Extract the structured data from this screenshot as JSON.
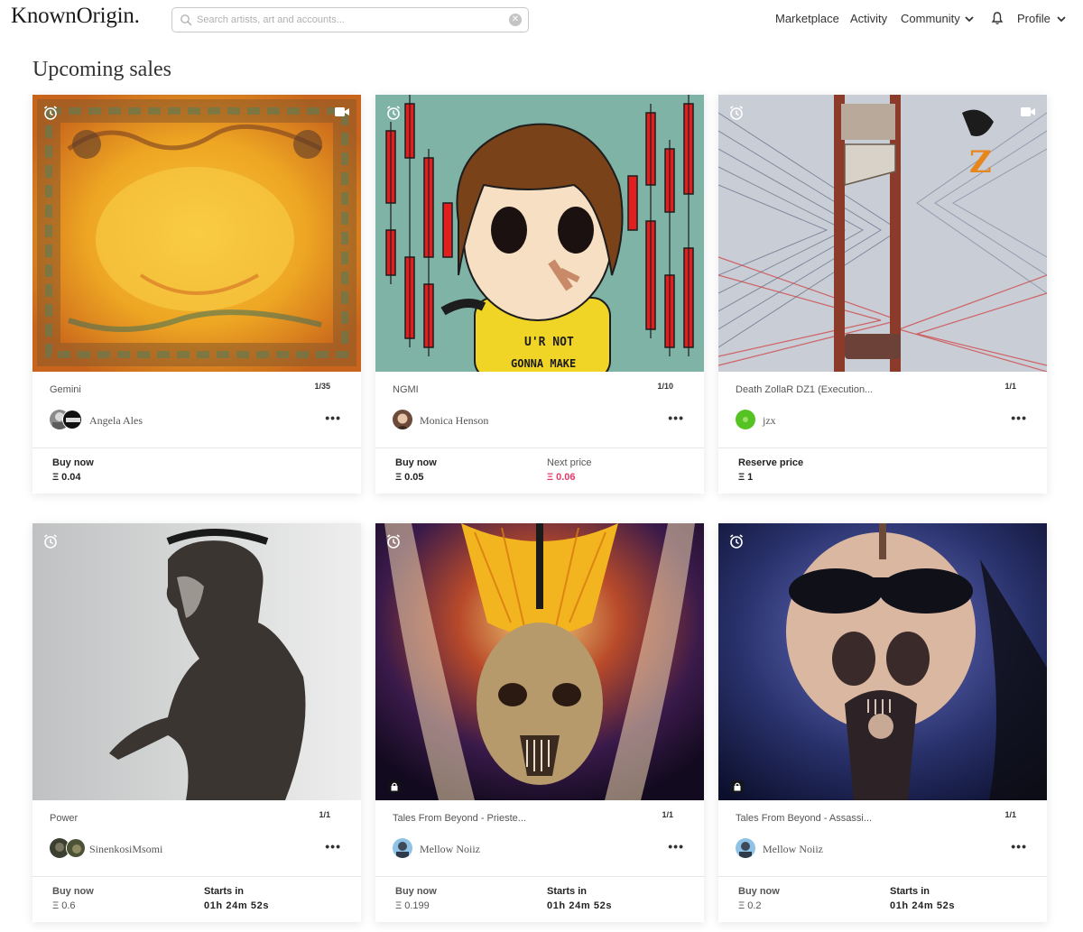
{
  "header": {
    "logo": "KnownOrigin.",
    "search_placeholder": "Search artists, art and accounts...",
    "nav": {
      "marketplace": "Marketplace",
      "activity": "Activity",
      "community": "Community",
      "profile": "Profile"
    }
  },
  "page": {
    "title": "Upcoming sales"
  },
  "cards": [
    {
      "title": "Gemini",
      "edition": "1/35",
      "artist": "Angela Ales",
      "price_label": "Buy now",
      "price": "Ξ 0.04",
      "secondary_label": "",
      "secondary_value": ""
    },
    {
      "title": "NGMI",
      "edition": "1/10",
      "artist": "Monica Henson",
      "price_label": "Buy now",
      "price": "Ξ 0.05",
      "secondary_label": "Next price",
      "secondary_value": "Ξ 0.06"
    },
    {
      "title": "Death ZollaR DZ1 (Execution...",
      "edition": "1/1",
      "artist": "jzx",
      "price_label": "Reserve price",
      "price": "Ξ 1",
      "secondary_label": "",
      "secondary_value": ""
    },
    {
      "title": "Power",
      "edition": "1/1",
      "artist": "SinenkosiMsomi",
      "price_label": "Buy now",
      "price": "Ξ 0.6",
      "secondary_label": "Starts in",
      "secondary_value": "01h 24m 52s"
    },
    {
      "title": "Tales From Beyond - Prieste...",
      "edition": "1/1",
      "artist": "Mellow Noiiz",
      "price_label": "Buy now",
      "price": "Ξ 0.199",
      "secondary_label": "Starts in",
      "secondary_value": "01h 24m 52s"
    },
    {
      "title": "Tales From Beyond - Assassi...",
      "edition": "1/1",
      "artist": "Mellow Noiiz",
      "price_label": "Buy now",
      "price": "Ξ 0.2",
      "secondary_label": "Starts in",
      "secondary_value": "01h 24m 52s"
    }
  ],
  "art_art_text": {
    "ngmi_shirt_line1": "U'R NOT",
    "ngmi_shirt_line2": "GONNA MAKE",
    "dz_logo": "Z"
  },
  "colors": {
    "accent_pink": "#e6386b",
    "text_dark": "#222222"
  }
}
